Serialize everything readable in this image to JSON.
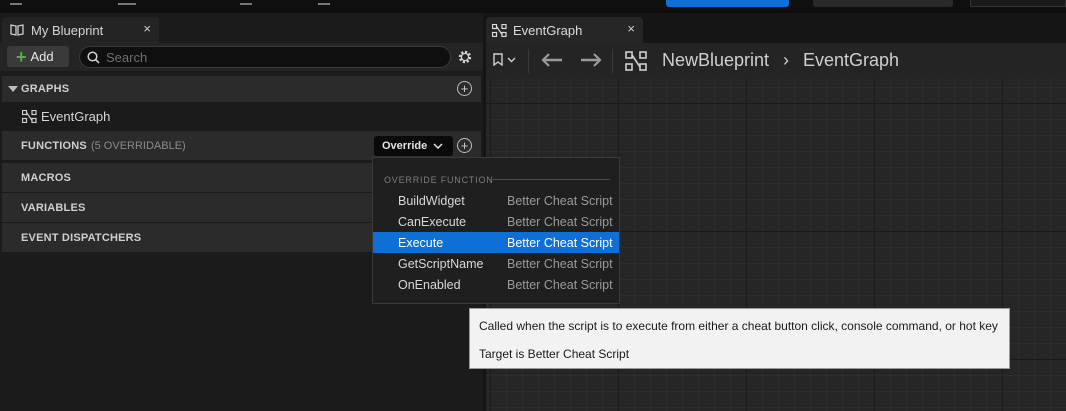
{
  "left_panel": {
    "tab_label": "My Blueprint",
    "tab_close": "×",
    "add_label": "Add",
    "search_placeholder": "Search",
    "sections": {
      "graphs": "GRAPHS",
      "functions": "FUNCTIONS",
      "functions_sub": "(5 OVERRIDABLE)",
      "macros": "MACROS",
      "variables": "VARIABLES",
      "event_dispatchers": "EVENT DISPATCHERS"
    },
    "graph_items": [
      "EventGraph"
    ],
    "override_label": "Override"
  },
  "override_menu": {
    "header": "OVERRIDE FUNCTION",
    "items": [
      {
        "name": "BuildWidget",
        "owner": "Better Cheat Script"
      },
      {
        "name": "CanExecute",
        "owner": "Better Cheat Script"
      },
      {
        "name": "Execute",
        "owner": "Better Cheat Script",
        "selected": true
      },
      {
        "name": "GetScriptName",
        "owner": "Better Cheat Script"
      },
      {
        "name": "OnEnabled",
        "owner": "Better Cheat Script"
      }
    ]
  },
  "graph_panel": {
    "tab_label": "EventGraph",
    "tab_close": "×",
    "breadcrumb": {
      "root": "NewBlueprint",
      "separator": "›",
      "current": "EventGraph"
    }
  },
  "tooltip": {
    "line1": "Called when the script is to execute from either a cheat button click, console command, or hot key",
    "line2": "Target is Better Cheat Script"
  },
  "colors": {
    "accent": "#0e6fd6",
    "add_plus": "#59b04a",
    "panel": "#1b1b1b",
    "section": "#2b2b2b"
  },
  "icons": [
    "book-icon",
    "search-icon",
    "gear-icon",
    "plus-circle-icon",
    "graph-icon",
    "chevron-down-icon",
    "bookmark-icon",
    "back-arrow-icon",
    "forward-arrow-icon",
    "close-icon"
  ]
}
